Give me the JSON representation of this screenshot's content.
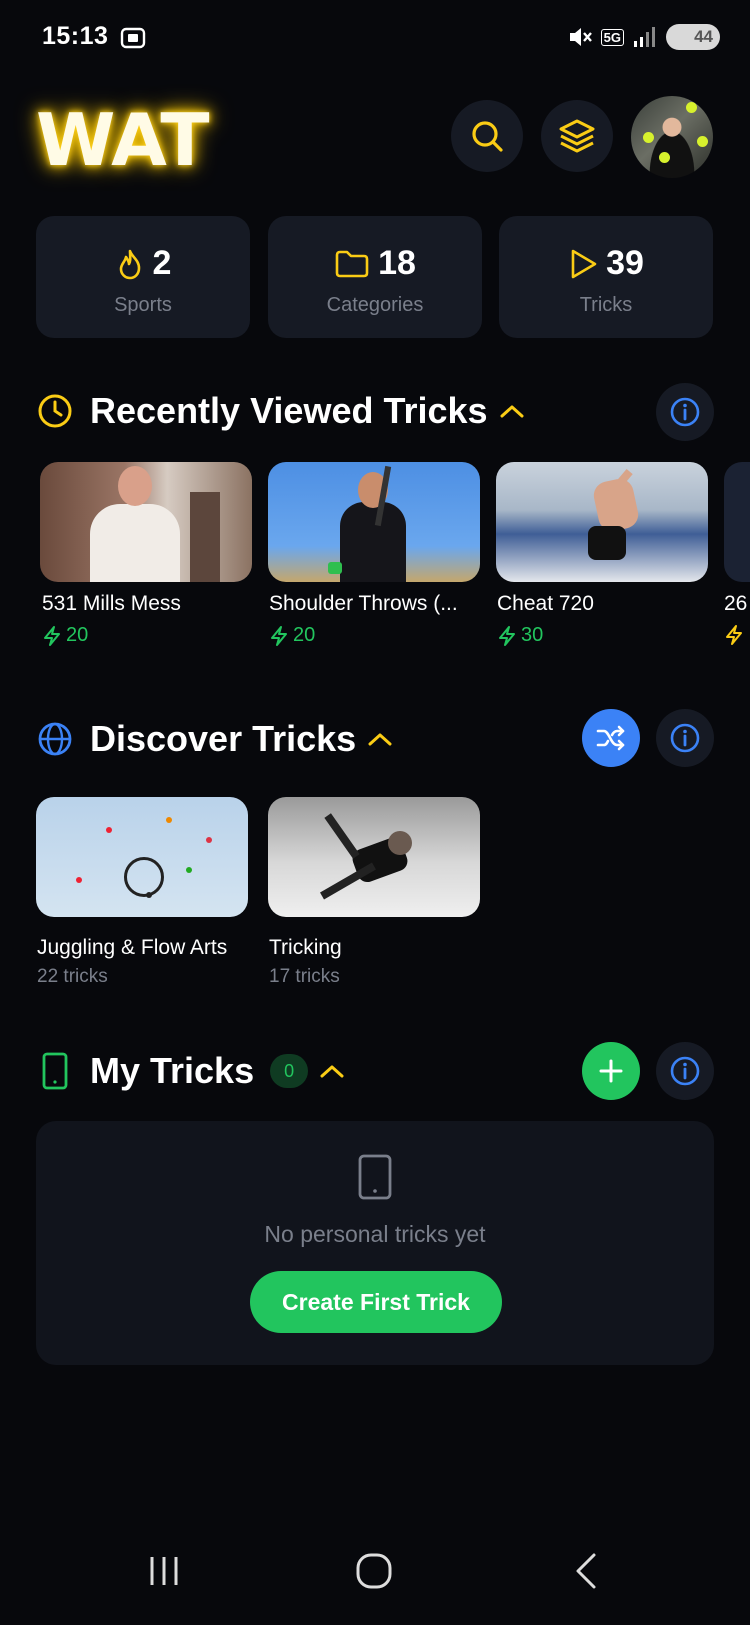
{
  "status_bar": {
    "time": "15:13",
    "network": "5G",
    "battery": "44"
  },
  "header": {
    "logo": "WAT"
  },
  "stats": [
    {
      "value": "2",
      "label": "Sports",
      "icon": "flame-icon"
    },
    {
      "value": "18",
      "label": "Categories",
      "icon": "folder-icon"
    },
    {
      "value": "39",
      "label": "Tricks",
      "icon": "play-icon"
    }
  ],
  "recent": {
    "title": "Recently Viewed Tricks",
    "items": [
      {
        "title": "531 Mills Mess",
        "points": "20"
      },
      {
        "title": "Shoulder Throws (...",
        "points": "20"
      },
      {
        "title": "Cheat 720",
        "points": "30"
      },
      {
        "title": "26",
        "points": ""
      }
    ]
  },
  "discover": {
    "title": "Discover Tricks",
    "items": [
      {
        "title": "Juggling & Flow Arts",
        "count": "22 tricks"
      },
      {
        "title": "Tricking",
        "count": "17 tricks"
      }
    ]
  },
  "my_tricks": {
    "title": "My Tricks",
    "count": "0",
    "empty_text": "No personal tricks yet",
    "create_label": "Create First Trick"
  },
  "colors": {
    "accent_yellow": "#facc15",
    "green": "#22c55e",
    "blue": "#3b82f6",
    "card_bg": "#161a24"
  }
}
